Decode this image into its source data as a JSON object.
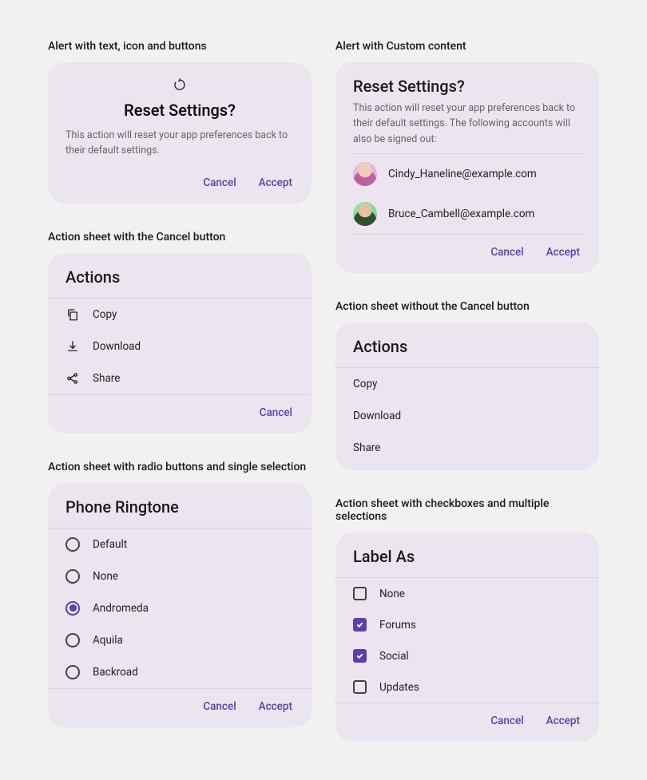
{
  "alert_icon": {
    "section": "Alert with text, icon and buttons",
    "title": "Reset Settings?",
    "desc": "This action will reset your app preferences back to their default settings.",
    "cancel": "Cancel",
    "accept": "Accept"
  },
  "alert_custom": {
    "section": "Alert with Custom content",
    "title": "Reset Settings?",
    "desc": "This action will reset your app preferences back to their default settings. The following accounts will also be signed out:",
    "acct1": "Cindy_Haneline@example.com",
    "acct2": "Bruce_Cambell@example.com",
    "cancel": "Cancel",
    "accept": "Accept"
  },
  "sheet_cancel": {
    "section": "Action sheet with the Cancel button",
    "title": "Actions",
    "copy": "Copy",
    "download": "Download",
    "share": "Share",
    "cancel": "Cancel"
  },
  "sheet_nocancel": {
    "section": "Action sheet without the Cancel button",
    "title": "Actions",
    "copy": "Copy",
    "download": "Download",
    "share": "Share"
  },
  "sheet_radio": {
    "section": "Action sheet with radio buttons and single selection",
    "title": "Phone Ringtone",
    "o0": "Default",
    "o1": "None",
    "o2": "Andromeda",
    "o3": "Aquila",
    "o4": "Backroad",
    "cancel": "Cancel",
    "accept": "Accept"
  },
  "sheet_check": {
    "section": "Action sheet with checkboxes and multiple selections",
    "title": "Label As",
    "o0": "None",
    "o1": "Forums",
    "o2": "Social",
    "o3": "Updates",
    "cancel": "Cancel",
    "accept": "Accept"
  }
}
